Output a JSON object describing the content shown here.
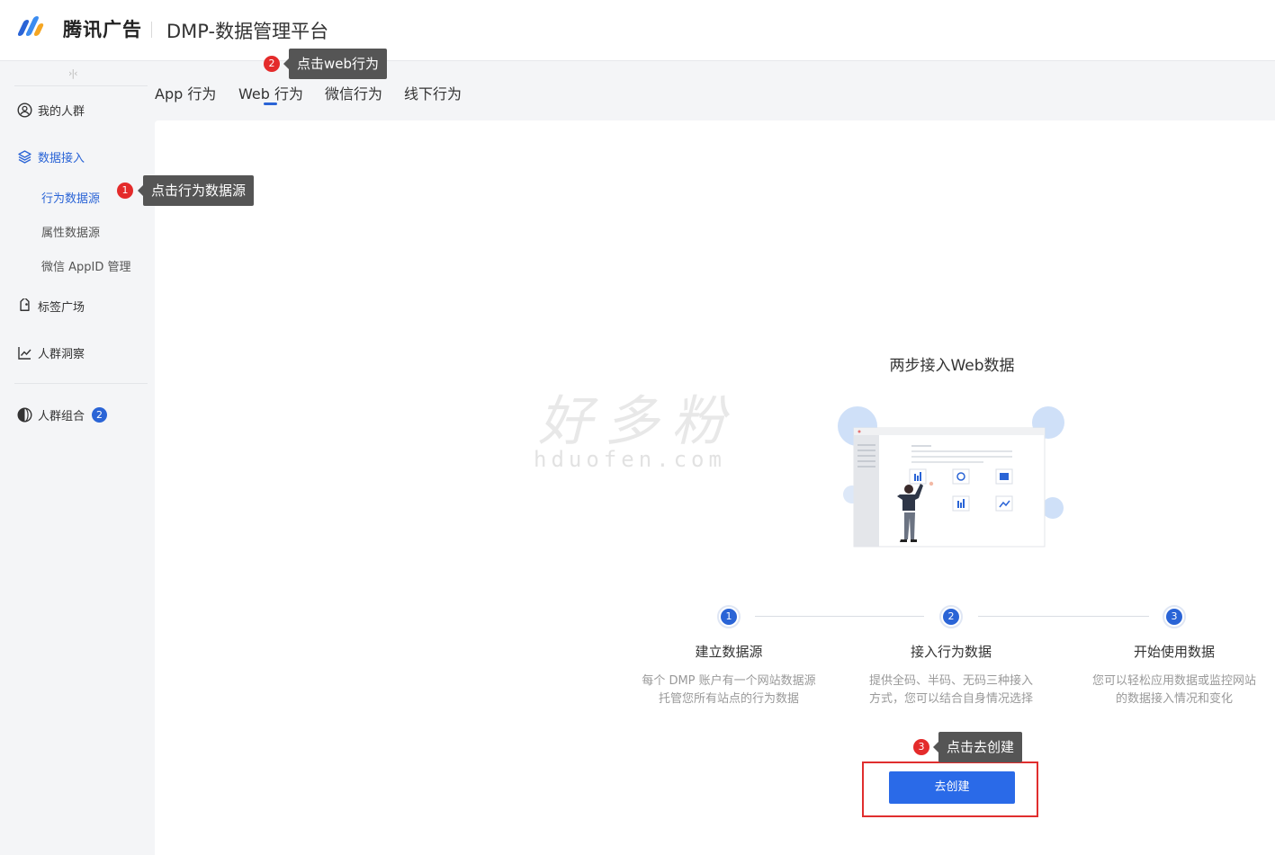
{
  "header": {
    "brand": "腾讯广告",
    "platform_title": "DMP-数据管理平台"
  },
  "sidebar": {
    "collapse_glyph": "›|‹",
    "items": [
      {
        "label": "我的人群",
        "icon": "user-circle-icon"
      },
      {
        "label": "数据接入",
        "icon": "layers-icon",
        "active": true
      },
      {
        "label": "标签广场",
        "icon": "tag-icon"
      },
      {
        "label": "人群洞察",
        "icon": "line-chart-icon"
      },
      {
        "label": "人群组合",
        "icon": "half-circle-icon",
        "badge": "2"
      }
    ],
    "sub_items": [
      {
        "label": "行为数据源",
        "active": true
      },
      {
        "label": "属性数据源"
      },
      {
        "label": "微信 AppID 管理"
      }
    ]
  },
  "tabs": [
    {
      "label": "App 行为"
    },
    {
      "label": "Web 行为",
      "active": true
    },
    {
      "label": "微信行为"
    },
    {
      "label": "线下行为"
    }
  ],
  "callouts": [
    {
      "num": "1",
      "text": "点击行为数据源"
    },
    {
      "num": "2",
      "text": "点击web行为"
    },
    {
      "num": "3",
      "text": "点击去创建"
    }
  ],
  "watermark": {
    "cn": "好多粉",
    "en": "hduofen.com"
  },
  "main": {
    "title": "两步接入Web数据",
    "steps": [
      {
        "num": "1",
        "title": "建立数据源",
        "desc_line1": "每个 DMP 账户有一个网站数据源",
        "desc_line2": "托管您所有站点的行为数据"
      },
      {
        "num": "2",
        "title": "接入行为数据",
        "desc_line1": "提供全码、半码、无码三种接入",
        "desc_line2": "方式，您可以结合自身情况选择"
      },
      {
        "num": "3",
        "title": "开始使用数据",
        "desc_line1": "您可以轻松应用数据或监控网站",
        "desc_line2": "的数据接入情况和变化"
      }
    ],
    "create_button": "去创建"
  },
  "colors": {
    "accent": "#2a64d6",
    "callout_bg": "#555555",
    "callout_num": "#e42b2b",
    "highlight_border": "#e02e2e"
  }
}
